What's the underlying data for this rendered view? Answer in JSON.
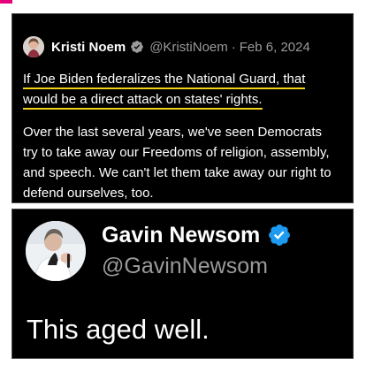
{
  "colors": {
    "background": "#ffffff",
    "card_background": "#000000",
    "text_primary": "#ffffff",
    "text_secondary": "#9a9a9a",
    "highlight": "#f0d21a",
    "verified": "#1d9bf0",
    "accent_tab": "#e6007a"
  },
  "top_tweet": {
    "author_name": "Kristi Noem",
    "handle": "@KristiNoem",
    "separator": "·",
    "date": "Feb 6, 2024",
    "verified_icon": "verified-badge-icon",
    "highlighted_line_1": "If Joe Biden federalizes the National Guard, that",
    "highlighted_line_2": "would be a direct attack on states' rights.",
    "paragraph_2": "Over the last several years, we've seen Democrats try to take away our Freedoms of religion, assembly, and speech. We can't let them take away our right to defend ourselves, too."
  },
  "bottom_tweet": {
    "author_name": "Gavin Newsom",
    "handle": "@GavinNewsom",
    "verified_icon": "verified-badge-icon",
    "text": "This aged well."
  }
}
